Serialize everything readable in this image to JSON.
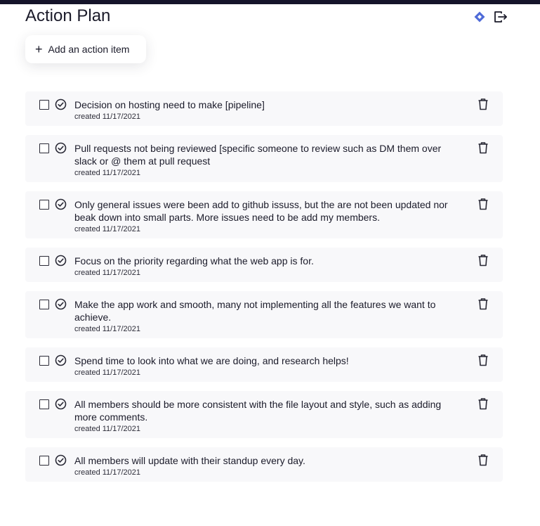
{
  "header": {
    "title": "Action Plan",
    "icons": [
      "diamond-icon",
      "export-icon"
    ],
    "accent": "#4f6bd8"
  },
  "add_button": {
    "label": "Add an action item",
    "icon": "plus-icon"
  },
  "items": [
    {
      "text": "Decision on hosting need to make [pipeline]",
      "date": "created 11/17/2021"
    },
    {
      "text": "Pull requests not being reviewed [specific someone to review such as DM them over slack or @ them at pull request",
      "date": "created 11/17/2021"
    },
    {
      "text": "Only general issues were been add to github issuss, but the are not been updated nor beak down into small parts. More issues need to be add my members.",
      "date": "created 11/17/2021"
    },
    {
      "text": "Focus on the priority regarding what the web app is for.",
      "date": "created 11/17/2021"
    },
    {
      "text": "Make the app work and smooth, many not implementing all the features we want to achieve.",
      "date": "created 11/17/2021"
    },
    {
      "text": "Spend time to look into what we are doing, and research helps!",
      "date": "created 11/17/2021"
    },
    {
      "text": "All members should be more consistent with the file layout and style, such as adding more comments.",
      "date": "created 11/17/2021"
    },
    {
      "text": "All members will update with their standup every day.",
      "date": "created 11/17/2021"
    }
  ]
}
